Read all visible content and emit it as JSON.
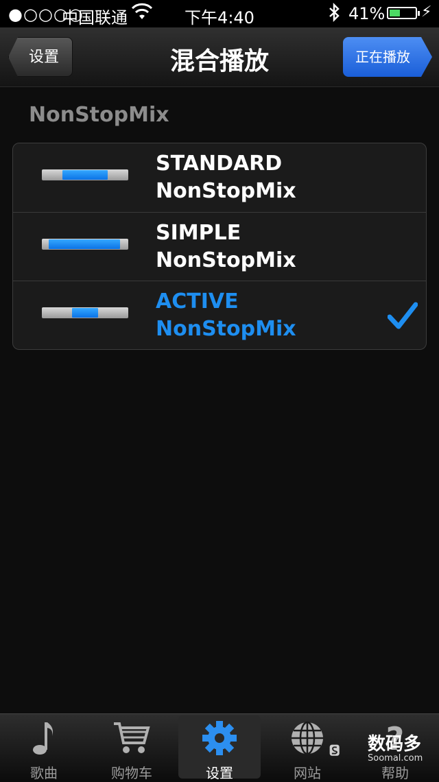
{
  "status_bar": {
    "signal": "●○○○○",
    "carrier": "中国联通",
    "time": "下午4:40",
    "battery_percent": "41%",
    "battery_level": 0.41
  },
  "nav": {
    "back_label": "设置",
    "title": "混合播放",
    "now_playing_label": "正在播放"
  },
  "section_header": "NonStopMix",
  "options": [
    {
      "line1": "STANDARD",
      "line2": "NonStopMix",
      "selected": false
    },
    {
      "line1": "SIMPLE",
      "line2": "NonStopMix",
      "selected": false
    },
    {
      "line1": "ACTIVE",
      "line2": "NonStopMix",
      "selected": true
    }
  ],
  "tabs": [
    {
      "label": "歌曲",
      "icon": "music-note-icon"
    },
    {
      "label": "购物车",
      "icon": "cart-icon"
    },
    {
      "label": "设置",
      "icon": "gear-icon",
      "selected": true
    },
    {
      "label": "网站",
      "icon": "globe-icon"
    },
    {
      "label": "帮助",
      "icon": "help-icon"
    }
  ],
  "watermark": {
    "text": "数码多",
    "sub": "Soomal.com"
  },
  "colors": {
    "accent": "#1e8ef0",
    "battery": "#4cd964"
  }
}
